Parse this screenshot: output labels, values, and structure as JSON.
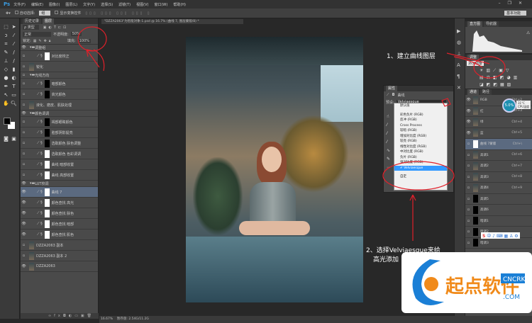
{
  "app": {
    "logo": "Ps",
    "menus": [
      "文件(F)",
      "编辑(E)",
      "图像(I)",
      "图层(L)",
      "文字(Y)",
      "选择(S)",
      "滤镜(T)",
      "视图(V)",
      "窗口(W)",
      "帮助(H)"
    ]
  },
  "options": {
    "auto_select": "自动选择:",
    "auto_select_value": "组",
    "show_transform": "显示变换控件",
    "workspace": "基本功能"
  },
  "doc_tab": "\"DZZA2063\"为智能对象-1.psd @ 16.7% (曲线 7, 图层蒙版/8) *",
  "layers_panel": {
    "tabs": [
      "历史记录",
      "图层"
    ],
    "kind": "类型",
    "blend": "正常",
    "opacity_label": "不透明度:",
    "opacity": "50%",
    "lock_label": "锁定:",
    "fill_label": "填充:",
    "fill": "100%",
    "rows": [
      {
        "name": "调整组",
        "type": "group",
        "eye": true
      },
      {
        "name": "对比度校正",
        "type": "adj",
        "thumb": "white"
      },
      {
        "name": "锐化",
        "type": "photo"
      },
      {
        "name": "光线方向",
        "type": "group"
      },
      {
        "name": "暗部颜色",
        "type": "adj",
        "thumb": "black"
      },
      {
        "name": "高光颜色",
        "type": "adj",
        "thumb": "black"
      },
      {
        "name": "液化、磨皮、肌肤处理",
        "type": "photo"
      },
      {
        "name": "颜色调调",
        "type": "group",
        "eye": true
      },
      {
        "name": "褐部眼睛颜色",
        "type": "adj",
        "thumb": "black"
      },
      {
        "name": "脸部阴影提亮",
        "type": "adj",
        "thumb": "black"
      },
      {
        "name": "选取颜色 肤色调整",
        "type": "adj",
        "thumb": "black"
      },
      {
        "name": "选取颜色 色彩调调",
        "type": "adj",
        "thumb": "white"
      },
      {
        "name": "曲线 暗部收置",
        "type": "adj",
        "thumb": "white"
      },
      {
        "name": "曲线 高部收置",
        "type": "adj",
        "thumb": "white"
      },
      {
        "name": "LUT校调",
        "type": "group",
        "eye": true
      },
      {
        "name": "曲线 7",
        "type": "adj",
        "thumb": "white",
        "selected": true,
        "eye": true
      },
      {
        "name": "颜色查找 高光",
        "type": "adj",
        "thumb": "white",
        "eye": true
      },
      {
        "name": "颜色查找 肤色",
        "type": "adj",
        "thumb": "white",
        "eye": true
      },
      {
        "name": "颜色查找 暗部",
        "type": "adj",
        "thumb": "white",
        "eye": true
      },
      {
        "name": "颜色查找 肌色",
        "type": "adj",
        "thumb": "white",
        "eye": true
      },
      {
        "name": "DZZA2063 副本",
        "type": "base"
      },
      {
        "name": "DZZA2063 副本 2",
        "type": "base"
      },
      {
        "name": "DZZA2063",
        "type": "base",
        "eye": true
      }
    ]
  },
  "properties": {
    "tab": "属性",
    "title": "曲线",
    "preset_label": "预设:",
    "preset_value": "Velviaesque",
    "options": [
      "默认值",
      "彩色负片 (RGB)",
      "反冲 (RGB)",
      "Cross Process",
      "较暗 (RGB)",
      "增加对比度 (RGB)",
      "较亮 (RGB)",
      "线性对比度 (RGB)",
      "中对比度 (RGB)",
      "负片 (RGB)",
      "强对比度 (RGB)",
      "Velviaesque",
      "自定"
    ],
    "selected_index": 11
  },
  "histogram": {
    "tabs": [
      "直方图",
      "导航器"
    ]
  },
  "adjustments": {
    "tab": "调整",
    "tooltip": "添加调整"
  },
  "channels": {
    "tabs": [
      "通道",
      "路径"
    ],
    "rows": [
      {
        "name": "RGB",
        "sc": "Ctrl+2",
        "eye": true
      },
      {
        "name": "红",
        "sc": "Ctrl+3",
        "eye": true
      },
      {
        "name": "绿",
        "sc": "Ctrl+4",
        "eye": true
      },
      {
        "name": "蓝",
        "sc": "Ctrl+5",
        "eye": true
      },
      {
        "name": "曲线 7蒙版",
        "sc": "Ctrl+\\",
        "sel": true
      },
      {
        "name": "高调1",
        "sc": "Ctrl+6"
      },
      {
        "name": "高调2",
        "sc": "Ctrl+7"
      },
      {
        "name": "高调3",
        "sc": "Ctrl+8"
      },
      {
        "name": "高调4",
        "sc": "Ctrl+9"
      },
      {
        "name": "高调5",
        "sc": ""
      },
      {
        "name": "高调6",
        "sc": ""
      },
      {
        "name": "暗调1",
        "sc": ""
      },
      {
        "name": "暗调2",
        "sc": ""
      },
      {
        "name": "暗调3",
        "sc": ""
      }
    ]
  },
  "cpu_widget": {
    "percent": "5.0%",
    "temp": "31°C",
    "label": "CPU温度"
  },
  "annotations": {
    "step1": "1、建立曲线图层",
    "step2_line1": "2、选择Velviaesque来给",
    "step2_line2": "高光添加"
  },
  "status": {
    "zoom": "16.67%",
    "doc": "暂存盘: 2.54G/11.2G"
  },
  "watermark": {
    "text": "起点软件",
    "sub1": "CNCRK",
    ".com": ".COM"
  }
}
